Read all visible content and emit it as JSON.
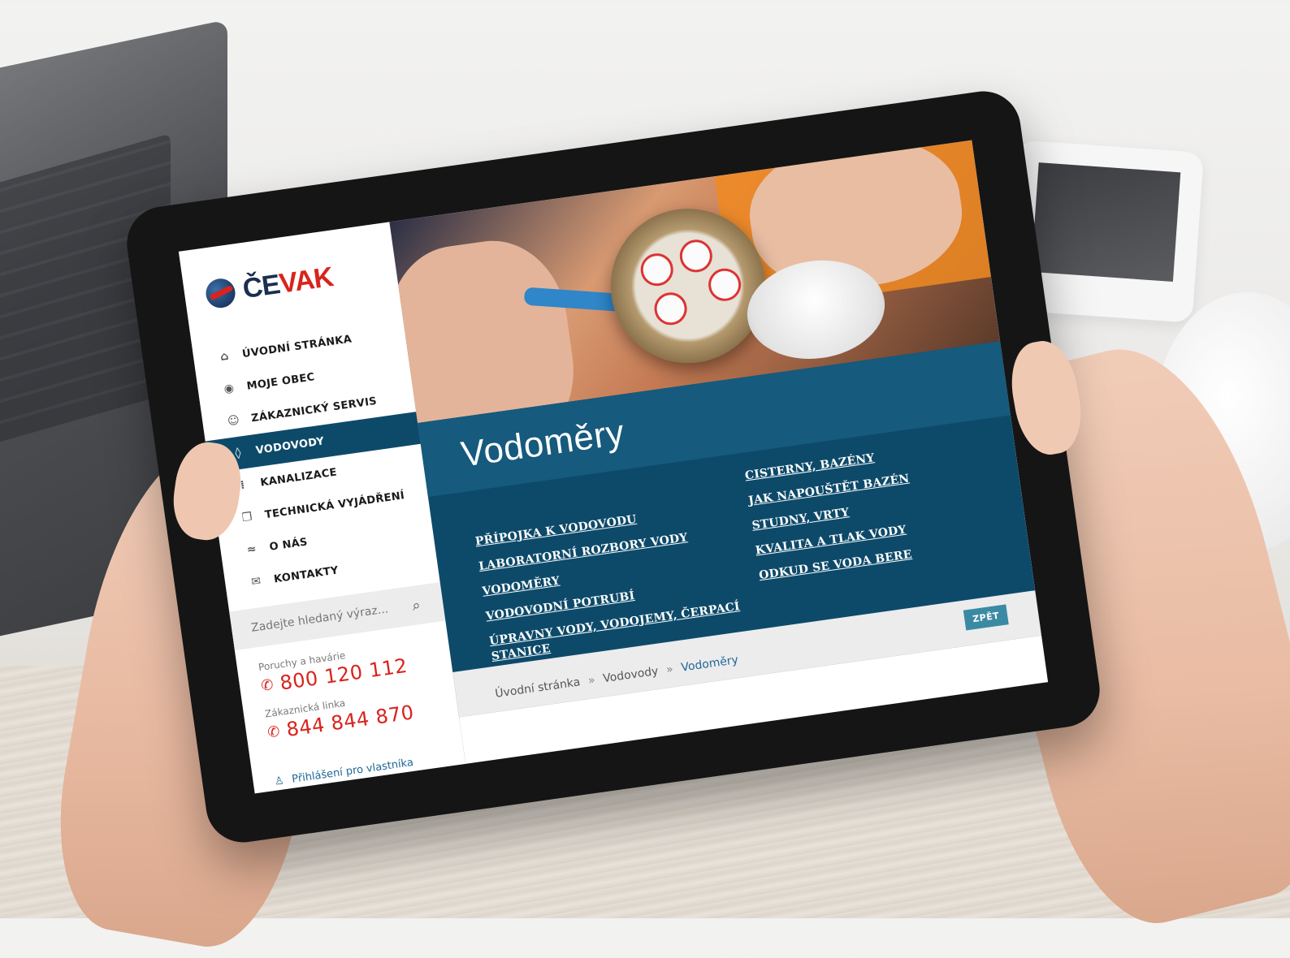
{
  "logo": {
    "part1": "ČE",
    "part2": "VAK"
  },
  "nav": [
    {
      "label": "ÚVODNÍ STRÁNKA",
      "icon": "home-icon",
      "active": false
    },
    {
      "label": "MOJE OBEC",
      "icon": "location-pin-icon",
      "active": false
    },
    {
      "label": "ZÁKAZNICKÝ SERVIS",
      "icon": "customer-service-icon",
      "active": false
    },
    {
      "label": "VODOVODY",
      "icon": "water-drop-icon",
      "active": true
    },
    {
      "label": "KANALIZACE",
      "icon": "sewer-icon",
      "active": false
    },
    {
      "label": "TECHNICKÁ VYJÁDŘENÍ",
      "icon": "documents-icon",
      "active": false
    },
    {
      "label": "O NÁS",
      "icon": "waves-icon",
      "active": false
    },
    {
      "label": "KONTAKTY",
      "icon": "envelope-icon",
      "active": false
    }
  ],
  "search": {
    "placeholder": "Zadejte hledaný výraz..."
  },
  "contacts": {
    "faults_label": "Poruchy a havárie",
    "faults_number": "800 120 112",
    "customer_label": "Zákaznická linka",
    "customer_number": "844 844 870"
  },
  "login": {
    "label": "Přihlášení pro vlastníka"
  },
  "page": {
    "title": "Vodoměry",
    "links_left": [
      "PŘÍPOJKA K VODOVODU",
      "LABORATORNÍ ROZBORY VODY",
      "VODOMĚRY",
      "VODOVODNÍ POTRUBÍ",
      "ÚPRAVNY VODY, VODOJEMY, ČERPACÍ STANICE"
    ],
    "links_right": [
      "CISTERNY, BAZÉNY",
      "JAK NAPOUŠTĚT BAZÉN",
      "STUDNY, VRTY",
      "KVALITA A TLAK VODY",
      "ODKUD SE VODA BERE"
    ],
    "back_label": "ZPĚT"
  },
  "breadcrumb": {
    "home": "Úvodní stránka",
    "section": "Vodovody",
    "current": "Vodoměry",
    "separator": "»"
  },
  "colors": {
    "brand_red": "#d9231d",
    "brand_navy": "#1b2f4f",
    "panel_blue": "#0d4a6a",
    "button_teal": "#3b8aa4"
  }
}
